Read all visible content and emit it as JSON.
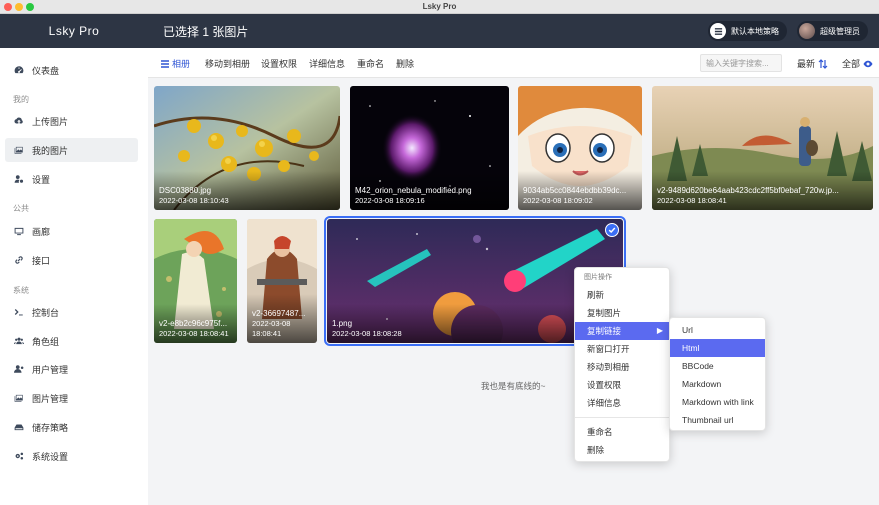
{
  "window": {
    "title": "Lsky Pro"
  },
  "sidebar": {
    "brand": "Lsky Pro",
    "items": [
      {
        "label": "仪表盘",
        "icon": "dashboard-icon",
        "active": false
      },
      {
        "label": "上传图片",
        "icon": "cloud-upload-icon",
        "active": false
      },
      {
        "label": "我的图片",
        "icon": "images-icon",
        "active": true
      },
      {
        "label": "设置",
        "icon": "user-gear-icon",
        "active": false
      },
      {
        "label": "画廊",
        "icon": "monitor-icon",
        "active": false
      },
      {
        "label": "接口",
        "icon": "link-icon",
        "active": false
      },
      {
        "label": "控制台",
        "icon": "terminal-icon",
        "active": false
      },
      {
        "label": "角色组",
        "icon": "users-icon",
        "active": false
      },
      {
        "label": "用户管理",
        "icon": "user-manage-icon",
        "active": false
      },
      {
        "label": "图片管理",
        "icon": "image-manage-icon",
        "active": false
      },
      {
        "label": "储存策略",
        "icon": "storage-icon",
        "active": false
      },
      {
        "label": "系统设置",
        "icon": "gears-icon",
        "active": false
      }
    ],
    "sections": {
      "mine": "我的",
      "public": "公共",
      "system": "系统"
    }
  },
  "header": {
    "title": "已选择 1 张图片",
    "strategy_label": "默认本地策略",
    "user_label": "超级管理员"
  },
  "toolbar": {
    "album": "相册",
    "move": "移动到相册",
    "permission": "设置权限",
    "details": "详细信息",
    "rename": "重命名",
    "delete": "删除",
    "search_placeholder": "输入关键字搜索...",
    "sort_label": "最新",
    "filter_label": "全部"
  },
  "images": [
    {
      "name": "DSC03880.jpg",
      "time": "2022-03-08 18:10:43",
      "selected": false
    },
    {
      "name": "M42_orion_nebula_modified.png",
      "time": "2022-03-08 18:09:16",
      "selected": false
    },
    {
      "name": "9034ab5cc0844ebdbb39dc...",
      "time": "2022-03-08 18:09:02",
      "selected": false
    },
    {
      "name": "v2-9489d620be64aab423cdc2ff5bf0ebaf_720w.jp...",
      "time": "2022-03-08 18:08:41",
      "selected": false
    },
    {
      "name": "v2-e8b2c96c975f...",
      "time": "2022-03-08 18:08:41",
      "selected": false
    },
    {
      "name": "v2-36697487...",
      "time": "2022-03-08",
      "time2": "18:08:41",
      "selected": false
    },
    {
      "name": "1.png",
      "time": "2022-03-08 18:08:28",
      "selected": true
    }
  ],
  "footer_text": "我也是有底线的~",
  "context_menu": {
    "header": "图片操作",
    "items": [
      "刷新",
      "复制图片",
      "复制链接",
      "新窗口打开",
      "移动到相册",
      "设置权限",
      "详细信息",
      "重命名",
      "删除"
    ],
    "highlighted": "复制链接"
  },
  "submenu": {
    "items": [
      "Url",
      "Html",
      "BBCode",
      "Markdown",
      "Markdown with link",
      "Thumbnail url"
    ],
    "highlighted": "Html"
  },
  "colors": {
    "dark": "#2d3544",
    "accent": "#3b6ef5",
    "menu_highlight": "#5b6af0"
  }
}
